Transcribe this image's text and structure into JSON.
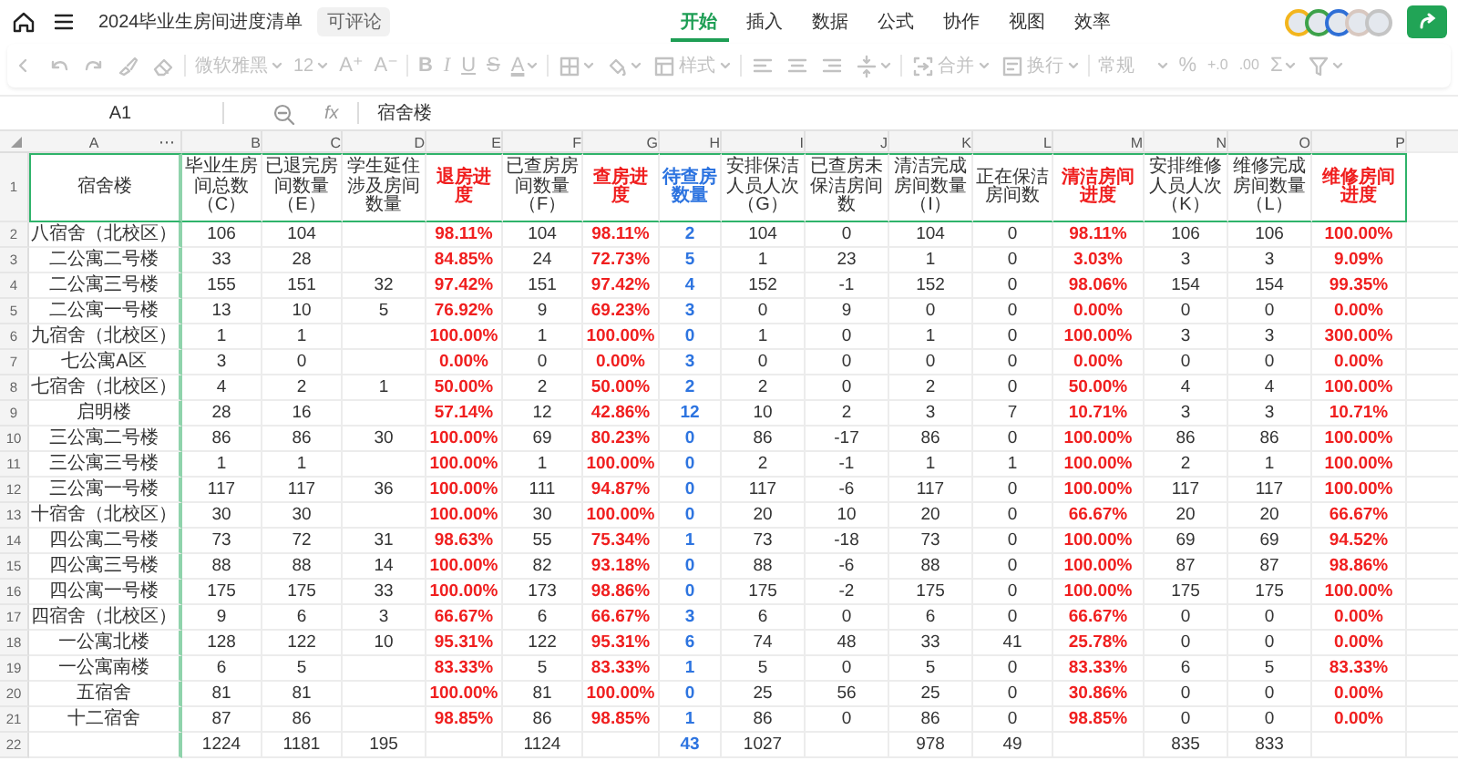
{
  "top_bar": {
    "title": "2024毕业生房间进度清单",
    "permission_badge": "可评论"
  },
  "menu_tabs": [
    {
      "label": "开始",
      "selected": true
    },
    {
      "label": "插入",
      "selected": false
    },
    {
      "label": "数据",
      "selected": false
    },
    {
      "label": "公式",
      "selected": false
    },
    {
      "label": "协作",
      "selected": false
    },
    {
      "label": "视图",
      "selected": false
    },
    {
      "label": "效率",
      "selected": false
    }
  ],
  "toolbar": {
    "disabled": true,
    "dropdowns": [
      "微软雅黑",
      "12",
      "样式",
      "合并",
      "换行",
      "常规"
    ],
    "glyph_buttons": [
      "A⁺",
      "A⁻",
      "B",
      "I",
      "U",
      "S",
      "A",
      "%",
      "+.0",
      ".00",
      "Σ"
    ]
  },
  "formula_bar": {
    "cell_reference": "A1",
    "function_label": "fx",
    "content": "宿舍楼"
  },
  "sheet": {
    "column_menu": "⋯",
    "header_row_number": "1",
    "columns": [
      {
        "letter": "A",
        "header": "宿舍楼",
        "kind": "label"
      },
      {
        "letter": "B",
        "header": "毕业生房间总数（C）",
        "kind": "number"
      },
      {
        "letter": "C",
        "header": "已退完房间数量（E）",
        "kind": "number"
      },
      {
        "letter": "D",
        "header": "学生延住涉及房间数量",
        "kind": "number"
      },
      {
        "letter": "E",
        "header": "退房进度",
        "kind": "rate"
      },
      {
        "letter": "F",
        "header": "已查房房间数量（F）",
        "kind": "number"
      },
      {
        "letter": "G",
        "header": "查房进度",
        "kind": "rate"
      },
      {
        "letter": "H",
        "header": "待查房数量",
        "kind": "pending"
      },
      {
        "letter": "I",
        "header": "安排保洁人员人次（G）",
        "kind": "number"
      },
      {
        "letter": "J",
        "header": "已查房未保洁房间数",
        "kind": "number"
      },
      {
        "letter": "K",
        "header": "清洁完成房间数量（I）",
        "kind": "number"
      },
      {
        "letter": "L",
        "header": "正在保洁房间数",
        "kind": "number"
      },
      {
        "letter": "M",
        "header": "清洁房间进度",
        "kind": "rate"
      },
      {
        "letter": "N",
        "header": "安排维修人员人次（K）",
        "kind": "number"
      },
      {
        "letter": "O",
        "header": "维修完成房间数量（L）",
        "kind": "number"
      },
      {
        "letter": "P",
        "header": "维修房间进度",
        "kind": "rate"
      }
    ],
    "rows": [
      {
        "number": "2",
        "cells": [
          "八宿舍（北校区）",
          "106",
          "104",
          null,
          "98.11%",
          "104",
          "98.11%",
          "2",
          "104",
          "0",
          "104",
          "0",
          "98.11%",
          "106",
          "106",
          "100.00%"
        ]
      },
      {
        "number": "3",
        "cells": [
          "二公寓二号楼",
          "33",
          "28",
          null,
          "84.85%",
          "24",
          "72.73%",
          "5",
          "1",
          "23",
          "1",
          "0",
          "3.03%",
          "3",
          "3",
          "9.09%"
        ]
      },
      {
        "number": "4",
        "cells": [
          "二公寓三号楼",
          "155",
          "151",
          "32",
          "97.42%",
          "151",
          "97.42%",
          "4",
          "152",
          "-1",
          "152",
          "0",
          "98.06%",
          "154",
          "154",
          "99.35%"
        ]
      },
      {
        "number": "5",
        "cells": [
          "二公寓一号楼",
          "13",
          "10",
          "5",
          "76.92%",
          "9",
          "69.23%",
          "3",
          "0",
          "9",
          "0",
          "0",
          "0.00%",
          "0",
          "0",
          "0.00%"
        ]
      },
      {
        "number": "6",
        "cells": [
          "九宿舍（北校区）",
          "1",
          "1",
          null,
          "100.00%",
          "1",
          "100.00%",
          "0",
          "1",
          "0",
          "1",
          "0",
          "100.00%",
          "3",
          "3",
          "300.00%"
        ]
      },
      {
        "number": "7",
        "cells": [
          "七公寓A区",
          "3",
          "0",
          null,
          "0.00%",
          "0",
          "0.00%",
          "3",
          "0",
          "0",
          "0",
          "0",
          "0.00%",
          "0",
          "0",
          "0.00%"
        ]
      },
      {
        "number": "8",
        "cells": [
          "七宿舍（北校区）",
          "4",
          "2",
          "1",
          "50.00%",
          "2",
          "50.00%",
          "2",
          "2",
          "0",
          "2",
          "0",
          "50.00%",
          "4",
          "4",
          "100.00%"
        ]
      },
      {
        "number": "9",
        "cells": [
          "启明楼",
          "28",
          "16",
          null,
          "57.14%",
          "12",
          "42.86%",
          "12",
          "10",
          "2",
          "3",
          "7",
          "10.71%",
          "3",
          "3",
          "10.71%"
        ]
      },
      {
        "number": "10",
        "cells": [
          "三公寓二号楼",
          "86",
          "86",
          "30",
          "100.00%",
          "69",
          "80.23%",
          "0",
          "86",
          "-17",
          "86",
          "0",
          "100.00%",
          "86",
          "86",
          "100.00%"
        ]
      },
      {
        "number": "11",
        "cells": [
          "三公寓三号楼",
          "1",
          "1",
          null,
          "100.00%",
          "1",
          "100.00%",
          "0",
          "2",
          "-1",
          "1",
          "1",
          "100.00%",
          "2",
          "1",
          "100.00%"
        ]
      },
      {
        "number": "12",
        "cells": [
          "三公寓一号楼",
          "117",
          "117",
          "36",
          "100.00%",
          "111",
          "94.87%",
          "0",
          "117",
          "-6",
          "117",
          "0",
          "100.00%",
          "117",
          "117",
          "100.00%"
        ]
      },
      {
        "number": "13",
        "cells": [
          "十宿舍（北校区）",
          "30",
          "30",
          null,
          "100.00%",
          "30",
          "100.00%",
          "0",
          "20",
          "10",
          "20",
          "0",
          "66.67%",
          "20",
          "20",
          "66.67%"
        ]
      },
      {
        "number": "14",
        "cells": [
          "四公寓二号楼",
          "73",
          "72",
          "31",
          "98.63%",
          "55",
          "75.34%",
          "1",
          "73",
          "-18",
          "73",
          "0",
          "100.00%",
          "69",
          "69",
          "94.52%"
        ]
      },
      {
        "number": "15",
        "cells": [
          "四公寓三号楼",
          "88",
          "88",
          "14",
          "100.00%",
          "82",
          "93.18%",
          "0",
          "88",
          "-6",
          "88",
          "0",
          "100.00%",
          "87",
          "87",
          "98.86%"
        ]
      },
      {
        "number": "16",
        "cells": [
          "四公寓一号楼",
          "175",
          "175",
          "33",
          "100.00%",
          "173",
          "98.86%",
          "0",
          "175",
          "-2",
          "175",
          "0",
          "100.00%",
          "175",
          "175",
          "100.00%"
        ]
      },
      {
        "number": "17",
        "cells": [
          "四宿舍（北校区）",
          "9",
          "6",
          "3",
          "66.67%",
          "6",
          "66.67%",
          "3",
          "6",
          "0",
          "6",
          "0",
          "66.67%",
          "0",
          "0",
          "0.00%"
        ]
      },
      {
        "number": "18",
        "cells": [
          "一公寓北楼",
          "128",
          "122",
          "10",
          "95.31%",
          "122",
          "95.31%",
          "6",
          "74",
          "48",
          "33",
          "41",
          "25.78%",
          "0",
          "0",
          "0.00%"
        ]
      },
      {
        "number": "19",
        "cells": [
          "一公寓南楼",
          "6",
          "5",
          null,
          "83.33%",
          "5",
          "83.33%",
          "1",
          "5",
          "0",
          "5",
          "0",
          "83.33%",
          "6",
          "5",
          "83.33%"
        ]
      },
      {
        "number": "20",
        "cells": [
          "五宿舍",
          "81",
          "81",
          null,
          "100.00%",
          "81",
          "100.00%",
          "0",
          "25",
          "56",
          "25",
          "0",
          "30.86%",
          "0",
          "0",
          "0.00%"
        ]
      },
      {
        "number": "21",
        "cells": [
          "十二宿舍",
          "87",
          "86",
          null,
          "98.85%",
          "86",
          "98.85%",
          "1",
          "86",
          "0",
          "86",
          "0",
          "98.85%",
          "0",
          "0",
          "0.00%"
        ]
      },
      {
        "number": "22",
        "cells": [
          null,
          "1224",
          "1181",
          "195",
          null,
          "1124",
          null,
          "43",
          "1027",
          null,
          "978",
          "49",
          null,
          "835",
          "833",
          null
        ]
      }
    ]
  }
}
